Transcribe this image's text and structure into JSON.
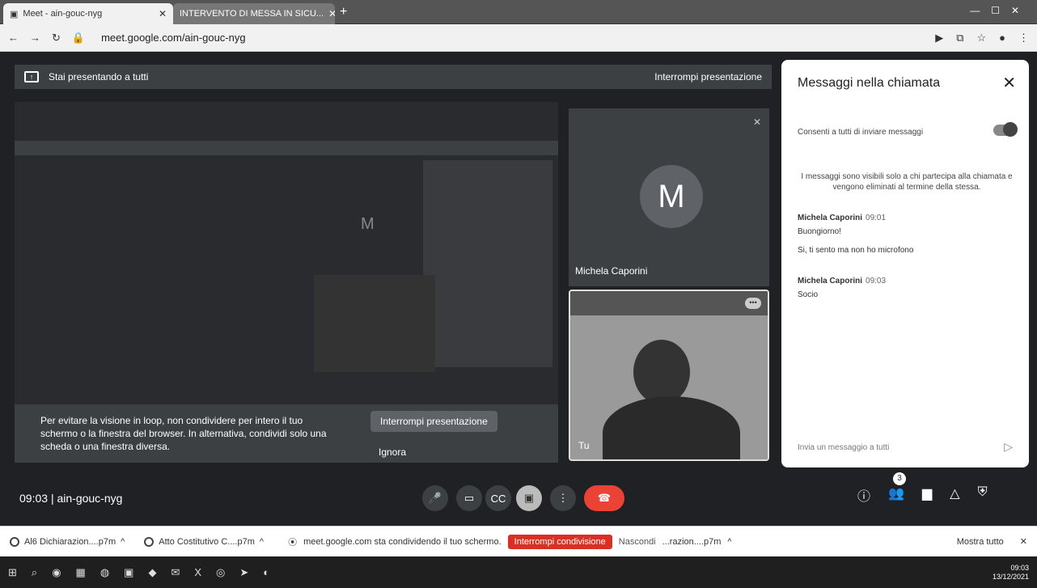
{
  "tabs": [
    {
      "label": "Meet - ain-gouc-nyg"
    },
    {
      "label": "INTERVENTO DI MESSA IN SICU..."
    }
  ],
  "address": {
    "url": "meet.google.com/ain-gouc-nyg"
  },
  "presentation": {
    "banner": "Stai presentando a tutti",
    "stop": "Interrompi presentazione"
  },
  "stage": {
    "avatar_letter": "M"
  },
  "tiles": {
    "michela_name": "Michela Caporini",
    "michela_initial": "M",
    "you_label": "Tu"
  },
  "warning": {
    "text": "Per evitare la visione in loop, non condividere per intero il tuo schermo o la finestra del browser. In alternativa, condividi solo una scheda o una finestra diversa.",
    "stop_button": "Interrompi presentazione",
    "ignore": "Ignora"
  },
  "meeting": {
    "time": "09:03",
    "separator": "|",
    "code": "ain-gouc-nyg",
    "participants_count": "3"
  },
  "chat": {
    "title": "Messaggi nella chiamata",
    "permission": "Consenti a tutti di inviare messaggi",
    "info": "I messaggi sono visibili solo a chi partecipa alla chiamata e vengono eliminati al termine della stessa.",
    "messages": [
      {
        "author": "Michela Caporini",
        "time": "09:01",
        "lines": [
          "Buongiorno!",
          "Si, ti sento ma non ho microfono"
        ]
      },
      {
        "author": "Michela Caporini",
        "time": "09:03",
        "lines": [
          "Socio"
        ]
      }
    ],
    "input_placeholder": "Invia un messaggio a tutti"
  },
  "downloads": {
    "items": [
      "Al6 Dichiarazion....p7m",
      "Atto Costitutivo C....p7m",
      "...razion....p7m"
    ],
    "share_text": "meet.google.com sta condividendo il tuo schermo.",
    "stop_share": "Interrompi condivisione",
    "hide": "Nascondi",
    "show_all": "Mostra tutto"
  },
  "taskbar": {
    "time": "09:03",
    "date": "13/12/2021"
  }
}
